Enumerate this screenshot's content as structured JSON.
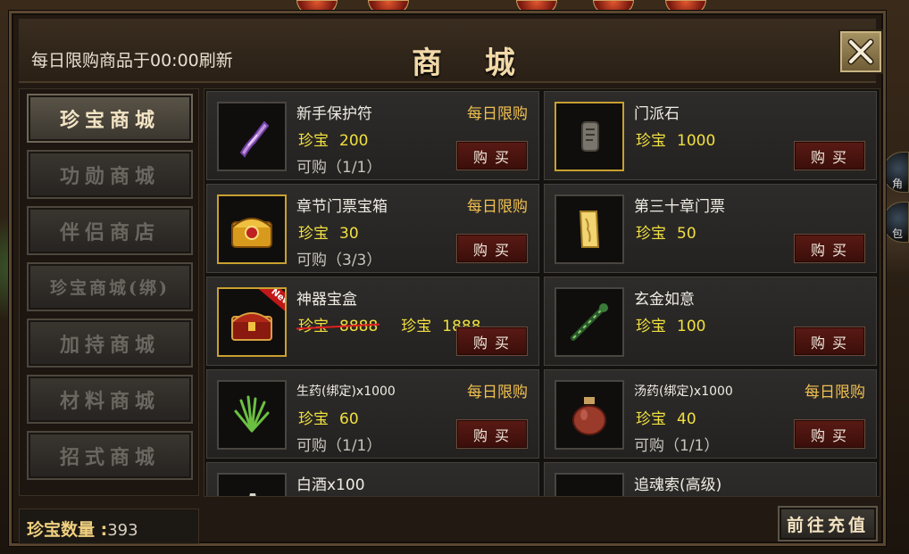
{
  "header": {
    "refresh_note": "每日限购商品于00:00刷新",
    "title": "商 城"
  },
  "sidebar": {
    "items": [
      {
        "label": "珍宝商城",
        "active": true
      },
      {
        "label": "功勋商城",
        "active": false
      },
      {
        "label": "伴侣商店",
        "active": false
      },
      {
        "label": "珍宝商城(绑)",
        "active": false
      },
      {
        "label": "加持商城",
        "active": false
      },
      {
        "label": "材料商城",
        "active": false
      },
      {
        "label": "招式商城",
        "active": false
      }
    ]
  },
  "balance": {
    "label": "珍宝数量 :",
    "value": "393"
  },
  "items": [
    {
      "name": "新手保护符",
      "limit_tag": "每日限购",
      "currency": "珍宝",
      "price": "200",
      "quota": "可购（1/1）",
      "buy": "购买",
      "icon": "scroll-icon"
    },
    {
      "name": "门派石",
      "limit_tag": "",
      "currency": "珍宝",
      "price": "1000",
      "quota": "",
      "buy": "购买",
      "icon": "stone-tablet-icon"
    },
    {
      "name": "章节门票宝箱",
      "limit_tag": "每日限购",
      "currency": "珍宝",
      "price": "30",
      "quota": "可购（3/3）",
      "buy": "购买",
      "icon": "gold-chest-icon"
    },
    {
      "name": "第三十章门票",
      "limit_tag": "",
      "currency": "珍宝",
      "price": "50",
      "quota": "",
      "buy": "购买",
      "icon": "ticket-icon"
    },
    {
      "name": "神器宝盒",
      "limit_tag": "",
      "currency": "珍宝",
      "old_price": "8888",
      "new_currency": "珍宝",
      "price": "1888",
      "quota": "",
      "buy": "购买",
      "badge": "New",
      "icon": "red-chest-icon"
    },
    {
      "name": "玄金如意",
      "limit_tag": "",
      "currency": "珍宝",
      "price": "100",
      "quota": "",
      "buy": "购买",
      "icon": "ruyi-icon"
    },
    {
      "name": "生药(绑定)x1000",
      "limit_tag": "每日限购",
      "currency": "珍宝",
      "price": "60",
      "quota": "可购（1/1）",
      "buy": "购买",
      "icon": "herb-icon"
    },
    {
      "name": "汤药(绑定)x1000",
      "limit_tag": "每日限购",
      "currency": "珍宝",
      "price": "40",
      "quota": "可购（1/1）",
      "buy": "购买",
      "icon": "potion-jar-icon"
    },
    {
      "name": "白酒x100",
      "icon": "wine-icon"
    },
    {
      "name": "追魂索(高级)",
      "icon": "rope-icon"
    }
  ],
  "recharge_label": "前往充值",
  "background": {
    "right_buttons": [
      "角",
      "包"
    ]
  }
}
